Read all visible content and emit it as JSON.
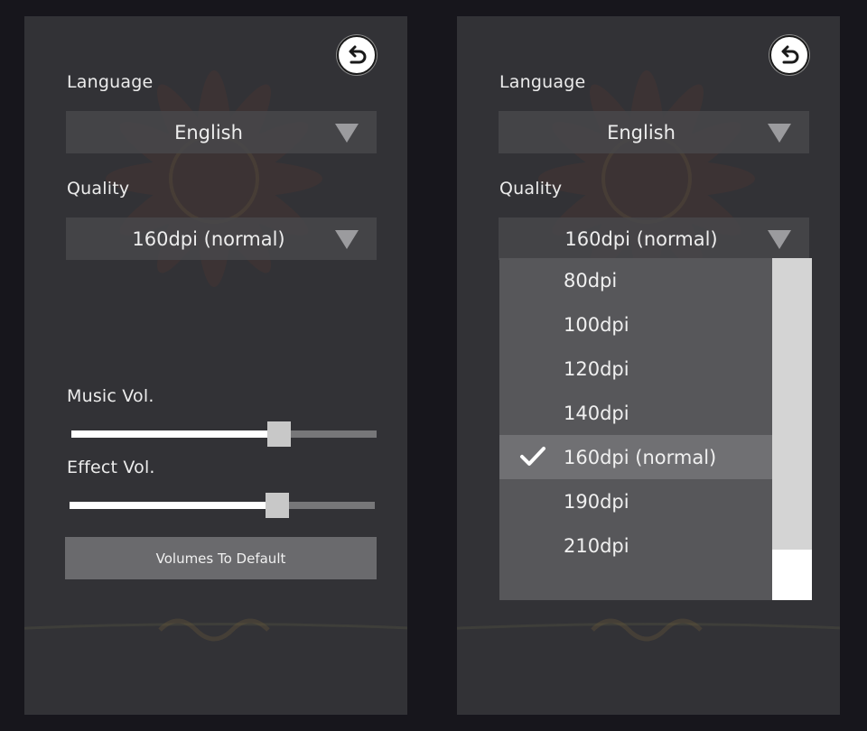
{
  "left_panel": {
    "language_label": "Language",
    "language_value": "English",
    "quality_label": "Quality",
    "quality_value": "160dpi (normal)",
    "music_label": "Music Vol.",
    "music_level": 0.68,
    "effect_label": "Effect Vol.",
    "effect_level": 0.68,
    "default_button": "Volumes To Default"
  },
  "right_panel": {
    "language_label": "Language",
    "language_value": "English",
    "quality_label": "Quality",
    "quality_value": "160dpi (normal)",
    "quality_options": [
      "80dpi",
      "100dpi",
      "120dpi",
      "140dpi",
      "160dpi (normal)",
      "190dpi",
      "210dpi"
    ],
    "selected_index": 4
  },
  "icons": {
    "back": "undo-arrow-icon",
    "arrow": "triangle-down-icon",
    "check": "checkmark-icon"
  },
  "colors": {
    "panel_bg": "#323236",
    "field_bg": "#48484c",
    "button_bg": "#6a6a6d",
    "dropdown_bg": "#57575a",
    "selected_bg": "#707073"
  }
}
